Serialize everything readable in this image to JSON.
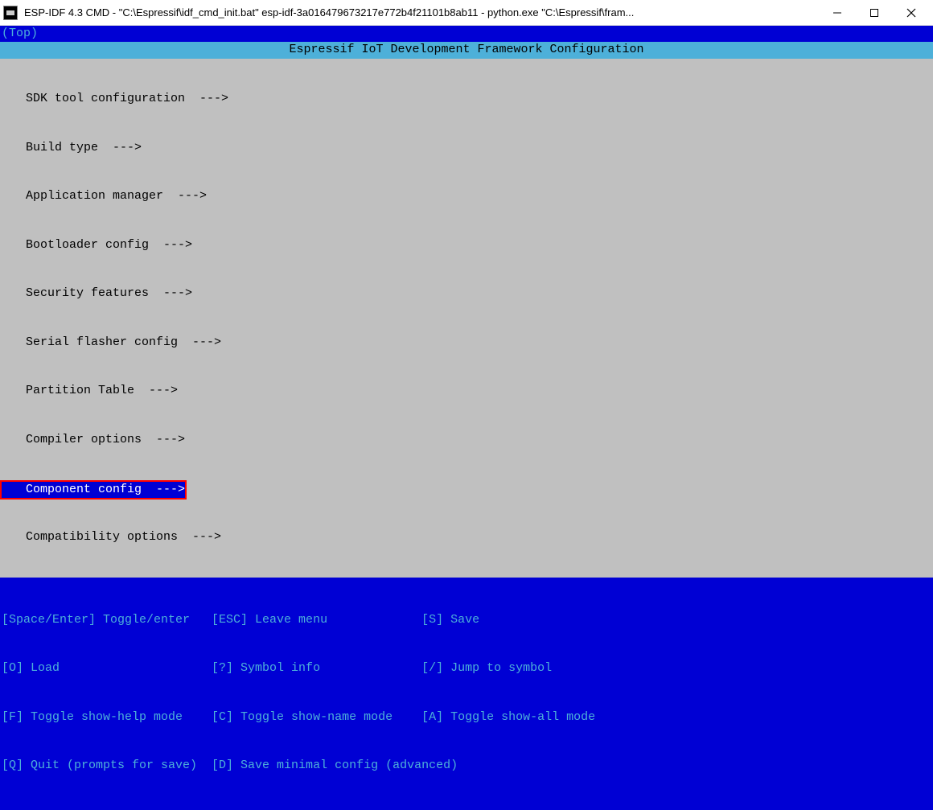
{
  "window": {
    "title": "ESP-IDF 4.3 CMD - \"C:\\Espressif\\idf_cmd_init.bat\"  esp-idf-3a016479673217e772b4f21101b8ab11 - python.exe  \"C:\\Espressif\\fram..."
  },
  "breadcrumb": "(Top)",
  "header": "Espressif IoT Development Framework Configuration",
  "menu": {
    "items": [
      {
        "label": "SDK tool configuration  --->",
        "selected": false
      },
      {
        "label": "Build type  --->",
        "selected": false
      },
      {
        "label": "Application manager  --->",
        "selected": false
      },
      {
        "label": "Bootloader config  --->",
        "selected": false
      },
      {
        "label": "Security features  --->",
        "selected": false
      },
      {
        "label": "Serial flasher config  --->",
        "selected": false
      },
      {
        "label": "Partition Table  --->",
        "selected": false
      },
      {
        "label": "Compiler options  --->",
        "selected": false
      },
      {
        "label": "Component config  --->",
        "selected": true
      },
      {
        "label": "Compatibility options  --->",
        "selected": false
      }
    ]
  },
  "footer": {
    "rows": [
      "[Space/Enter] Toggle/enter   [ESC] Leave menu             [S] Save",
      "[O] Load                     [?] Symbol info              [/] Jump to symbol",
      "[F] Toggle show-help mode    [C] Toggle show-name mode    [A] Toggle show-all mode",
      "[Q] Quit (prompts for save)  [D] Save minimal config (advanced)"
    ]
  }
}
